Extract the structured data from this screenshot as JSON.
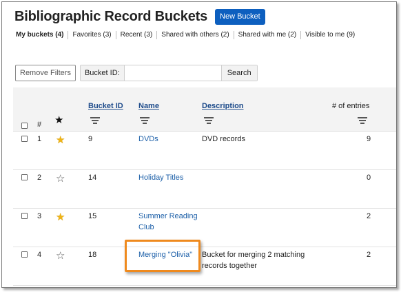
{
  "header": {
    "title": "Bibliographic Record Buckets",
    "new_bucket_label": "New Bucket"
  },
  "tabs": [
    {
      "label": "My buckets (4)",
      "active": true
    },
    {
      "label": "Favorites (3)",
      "active": false
    },
    {
      "label": "Recent (3)",
      "active": false
    },
    {
      "label": "Shared with others (2)",
      "active": false
    },
    {
      "label": "Shared with me (2)",
      "active": false
    },
    {
      "label": "Visible to me (9)",
      "active": false
    }
  ],
  "filters": {
    "remove_filters_label": "Remove Filters",
    "bucket_id_label": "Bucket ID:",
    "bucket_id_value": "",
    "search_label": "Search"
  },
  "columns": {
    "number": "#",
    "bucket_id": "Bucket ID",
    "name": "Name",
    "description": "Description",
    "entries": "# of entries"
  },
  "rows": [
    {
      "index": "1",
      "favorite": true,
      "bucket_id": "9",
      "name_lines": [
        "DVDs"
      ],
      "description_lines": [
        "DVD records"
      ],
      "entries": "9"
    },
    {
      "index": "2",
      "favorite": false,
      "bucket_id": "14",
      "name_lines": [
        "Holiday Titles"
      ],
      "description_lines": [],
      "entries": "0"
    },
    {
      "index": "3",
      "favorite": true,
      "bucket_id": "15",
      "name_lines": [
        "Summer Reading",
        "Club"
      ],
      "description_lines": [],
      "entries": "2"
    },
    {
      "index": "4",
      "favorite": false,
      "bucket_id": "18",
      "name_lines": [
        "Merging \"Olivia\""
      ],
      "description_lines": [
        "Bucket for merging 2 matching",
        "records together"
      ],
      "entries": "2"
    }
  ],
  "colors": {
    "primary_button": "#0d5fbf",
    "link": "#1c5fa8",
    "star_filled": "#f0b416",
    "highlight_border": "#ef8a1e"
  }
}
